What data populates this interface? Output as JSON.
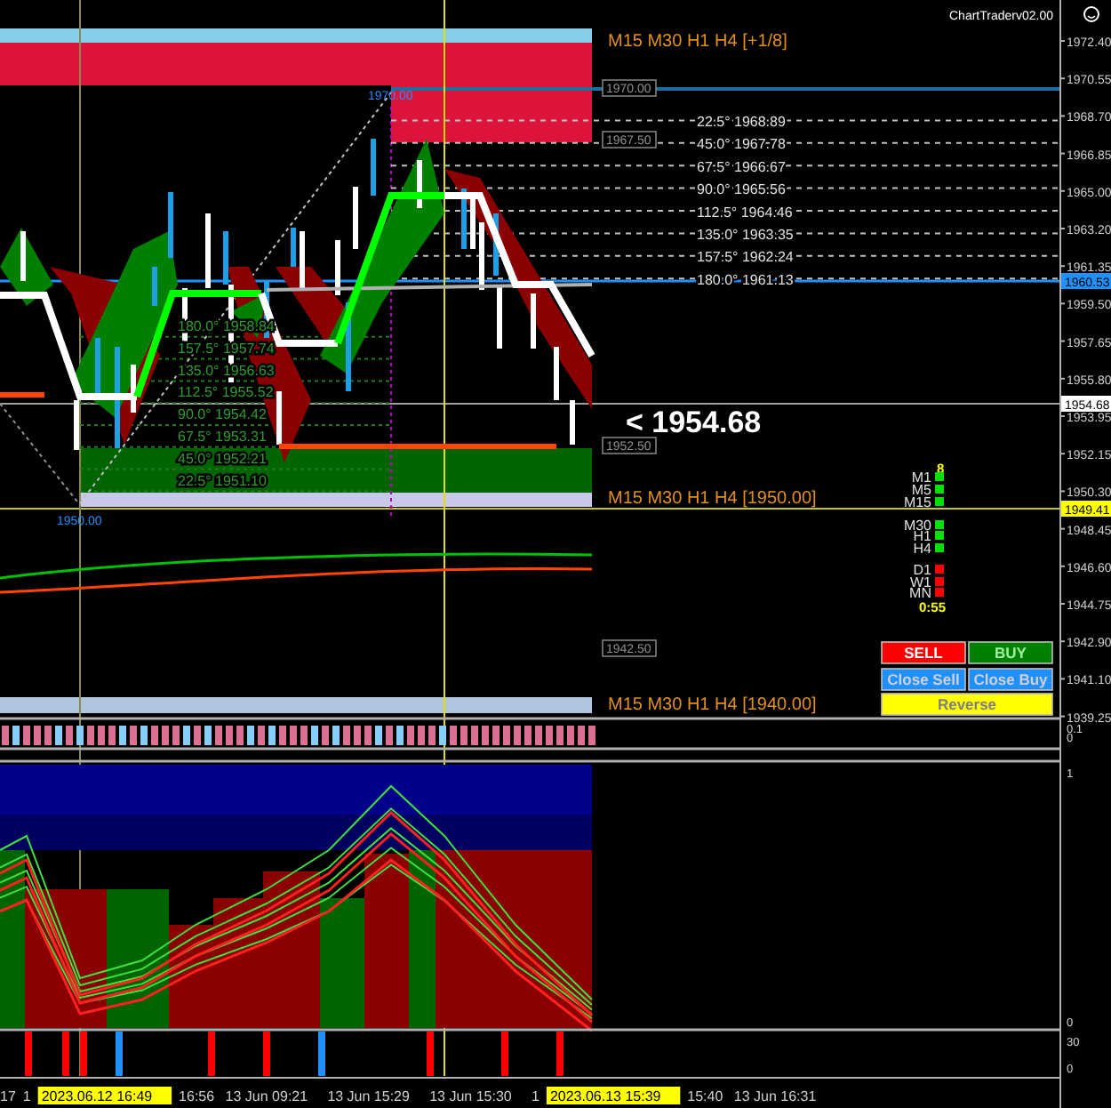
{
  "header": {
    "title": "ChartTraderv02.00"
  },
  "zone_labels": [
    "M15 M30 H1 H4 [+1/8]",
    "M15 M30 H1 H4  [1950.00]",
    "M15 M30 H1 H4  [1940.00]"
  ],
  "bid_display": "<  1954.68",
  "gann_upper": [
    "22.5° 1968.89",
    "45.0° 1967.78",
    "67.5° 1966.67",
    "90.0° 1965.56",
    "112.5° 1964.46",
    "135.0° 1963.35",
    "157.5° 1962.24",
    "180.0° 1961.13"
  ],
  "gann_lower": [
    "180.0° 1958.84",
    "157.5° 1957.74",
    "135.0° 1956.63",
    "112.5° 1955.52",
    "90.0° 1954.42",
    "67.5° 1953.31",
    "45.0° 1952.21",
    "22.5° 1951.10"
  ],
  "level_boxes": [
    "1970.00",
    "1967.50",
    "1952.50",
    "1942.50"
  ],
  "fan_anchors": [
    "1970.00",
    "1950.00"
  ],
  "timeframes": {
    "count": "8",
    "groups": [
      [
        {
          "label": "M1",
          "color": "#00e000"
        },
        {
          "label": "M5",
          "color": "#00e000"
        },
        {
          "label": "M15",
          "color": "#00e000"
        }
      ],
      [
        {
          "label": "M30",
          "color": "#00e000"
        },
        {
          "label": "H1",
          "color": "#00e000"
        },
        {
          "label": "H4",
          "color": "#00e000"
        }
      ],
      [
        {
          "label": "D1",
          "color": "#ff0000"
        },
        {
          "label": "W1",
          "color": "#ff0000"
        },
        {
          "label": "MN",
          "color": "#ff0000"
        }
      ]
    ],
    "timer": "0:55"
  },
  "buttons": [
    {
      "label": "SELL",
      "kind": "sell"
    },
    {
      "label": "BUY",
      "kind": "buy"
    },
    {
      "label": "Close Sell",
      "kind": "close"
    },
    {
      "label": "Close Buy",
      "kind": "close"
    },
    {
      "label": "Reverse",
      "kind": "reverse"
    }
  ],
  "price_axis": {
    "ticks": [
      "1972.40",
      "1970.55",
      "1968.70",
      "1966.85",
      "1965.00",
      "1963.20",
      "1961.35",
      "1959.50",
      "1957.65",
      "1955.80",
      "1953.95",
      "1952.15",
      "1950.30",
      "1948.45",
      "1946.60",
      "1944.75",
      "1942.90",
      "1941.10",
      "1939.25"
    ],
    "tags": [
      {
        "text": "1960.53",
        "kind": "line"
      },
      {
        "text": "1954.68",
        "kind": "bid"
      },
      {
        "text": "1949.41",
        "kind": "cursor"
      }
    ]
  },
  "strip_axis": [
    "0.1",
    "0"
  ],
  "oscillator_axis": [
    "1",
    "0"
  ],
  "histogram_axis": [
    "30",
    "0"
  ],
  "time_axis": [
    {
      "text": "17",
      "kind": "label"
    },
    {
      "text": "1",
      "kind": "label"
    },
    {
      "text": "2023.06.12 16:49",
      "kind": "cursor"
    },
    {
      "text": "16:56",
      "kind": "label"
    },
    {
      "text": "13 Jun 09:21",
      "kind": "label"
    },
    {
      "text": "13 Jun 15:29",
      "kind": "label"
    },
    {
      "text": "13 Jun 15:30",
      "kind": "label"
    },
    {
      "text": "1",
      "kind": "label"
    },
    {
      "text": "2023.06.13 15:39",
      "kind": "cursor"
    },
    {
      "text": "15:40",
      "kind": "label"
    },
    {
      "text": "13 Jun 16:31",
      "kind": "label"
    }
  ]
}
